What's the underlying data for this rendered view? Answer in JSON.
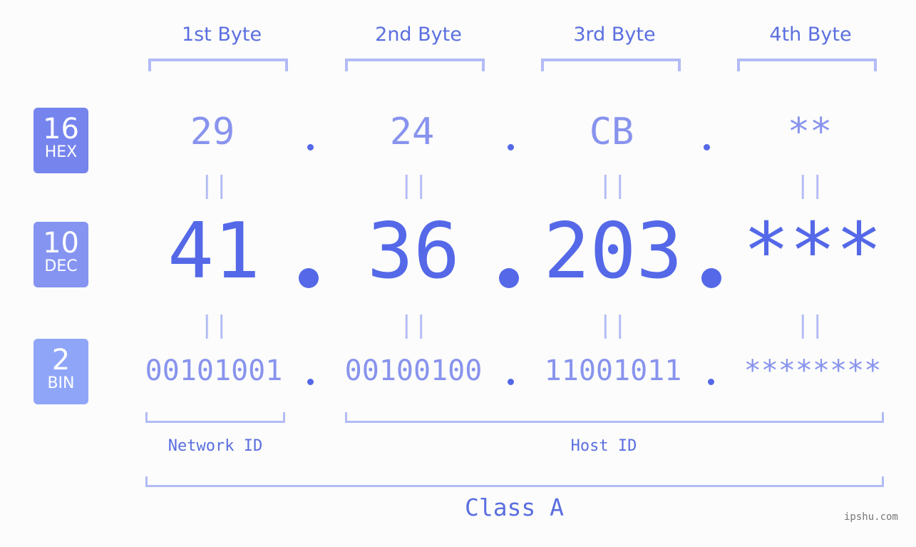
{
  "bytes": [
    {
      "header": "1st Byte",
      "hex": "29",
      "dec": "41",
      "bin": "00101001"
    },
    {
      "header": "2nd Byte",
      "hex": "24",
      "dec": "36",
      "bin": "00100100"
    },
    {
      "header": "3rd Byte",
      "hex": "CB",
      "dec": "203",
      "bin": "11001011"
    },
    {
      "header": "4th Byte",
      "hex": "**",
      "dec": "***",
      "bin": "********"
    }
  ],
  "badges": {
    "hex": {
      "num": "16",
      "label": "HEX",
      "color": "#7684ee"
    },
    "dec": {
      "num": "10",
      "label": "DEC",
      "color": "#8593f1"
    },
    "bin": {
      "num": "2",
      "label": "BIN",
      "color": "#8fa6f8"
    }
  },
  "equals_symbol": "||",
  "network_id_label": "Network ID",
  "host_id_label": "Host ID",
  "class_label": "Class A",
  "brand": "ipshu.com",
  "colors": {
    "accent": "#5468e8",
    "light": "#8893ee",
    "bracket": "#b3bbf7"
  }
}
